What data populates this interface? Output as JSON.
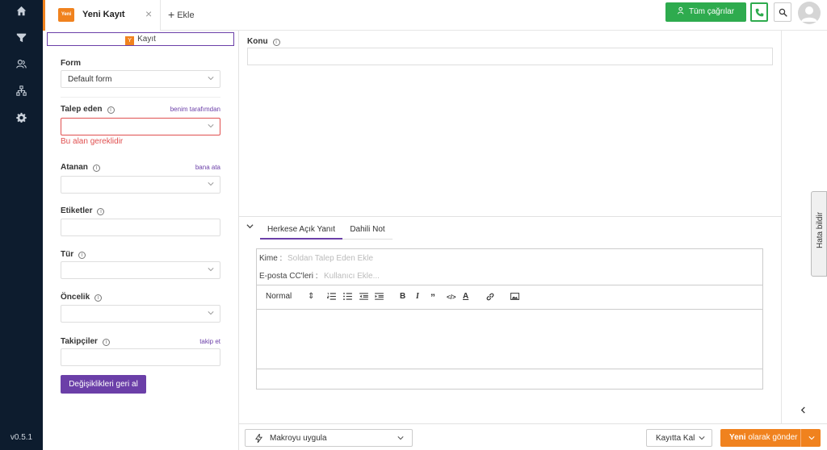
{
  "app": {
    "version": "v0.5.1"
  },
  "nav": {
    "items": [
      "home-icon",
      "filter-icon",
      "users-icon",
      "org-chart-icon",
      "gear-icon"
    ]
  },
  "tabs": {
    "active": {
      "badge": "Yeni",
      "title": "Yeni Kayıt",
      "close": "×"
    },
    "add_label": "Ekle"
  },
  "header": {
    "all_calls_label": "Tüm çağrılar"
  },
  "record_tag": {
    "badge": "Y",
    "label": "Kayıt"
  },
  "form": {
    "form_label": "Form",
    "form_value": "Default form",
    "requester_label": "Talep eden",
    "requester_link": "benim tarafımdan",
    "requester_error": "Bu alan gereklidir",
    "assignee_label": "Atanan",
    "assignee_link": "bana ata",
    "tags_label": "Etiketler",
    "type_label": "Tür",
    "priority_label": "Öncelik",
    "followers_label": "Takipçiler",
    "followers_link": "takip et",
    "revert_label": "Değişiklikleri geri al"
  },
  "subject": {
    "label": "Konu"
  },
  "reply": {
    "tab_public": "Herkese Açık Yanıt",
    "tab_internal": "Dahili Not",
    "to_label": "Kime :",
    "to_placeholder": "Soldan Talep Eden Ekle",
    "cc_label": "E-posta CC'leri :",
    "cc_placeholder": "Kullanıcı Ekle...",
    "format_value": "Normal",
    "format_arrows": "⇕"
  },
  "footer": {
    "macro_label": "Makroyu uygula",
    "stay_label": "Kayıtta Kal",
    "send_bold": "Yeni",
    "send_rest": " olarak gönder"
  },
  "feedback": {
    "label": "Hata bildir"
  },
  "colors": {
    "accent": "#6b3fa8",
    "brand": "#f0821e",
    "success": "#2eab4e",
    "error": "#e05050",
    "nav": "#0d1c2e"
  }
}
